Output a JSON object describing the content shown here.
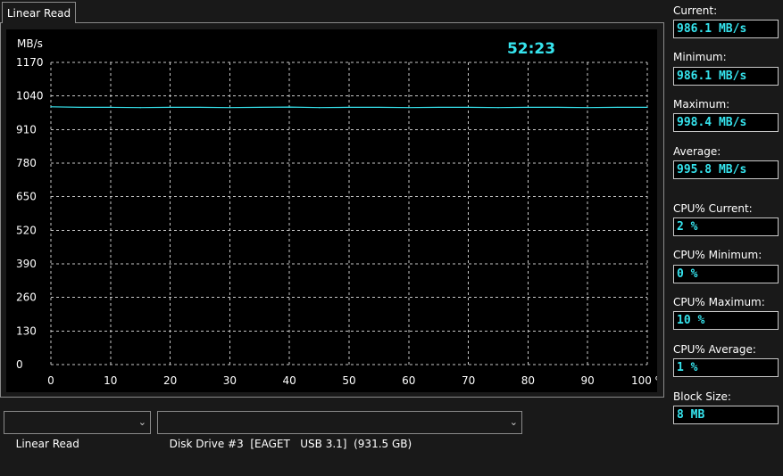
{
  "tab": {
    "label": "Linear Read"
  },
  "chart": {
    "timer": "52:23",
    "y_unit": "MB/s",
    "y_ticks": [
      "1170",
      "1040",
      "910",
      "780",
      "650",
      "520",
      "390",
      "260",
      "130",
      "0"
    ],
    "x_ticks": [
      "0",
      "10",
      "20",
      "30",
      "40",
      "50",
      "60",
      "70",
      "80",
      "90",
      "100 %"
    ],
    "colors": {
      "background": "#000000",
      "grid": "#c8c8c8",
      "line": "#36e4ee",
      "text": "#ffffff",
      "timer": "#36e4ee"
    }
  },
  "chart_data": {
    "type": "line",
    "title": "",
    "xlabel": "",
    "ylabel": "MB/s",
    "xlim": [
      0,
      100
    ],
    "ylim": [
      0,
      1170
    ],
    "grid": true,
    "series": [
      {
        "values_x": [
          0,
          5,
          10,
          15,
          20,
          25,
          30,
          35,
          40,
          45,
          50,
          55,
          60,
          65,
          70,
          75,
          80,
          85,
          90,
          95,
          100
        ],
        "values_y": [
          998,
          996,
          996,
          995,
          996,
          996,
          995,
          996,
          997,
          995,
          996,
          996,
          995,
          996,
          996,
          995,
          996,
          996,
          995,
          996,
          996
        ]
      }
    ]
  },
  "stats": {
    "current_label": "Current:",
    "current_value": "986.1 MB/s",
    "minimum_label": "Minimum:",
    "minimum_value": "986.1 MB/s",
    "maximum_label": "Maximum:",
    "maximum_value": "998.4 MB/s",
    "average_label": "Average:",
    "average_value": "995.8 MB/s",
    "cpu_current_label": "CPU% Current:",
    "cpu_current_value": "2 %",
    "cpu_minimum_label": "CPU% Minimum:",
    "cpu_minimum_value": "0 %",
    "cpu_maximum_label": "CPU% Maximum:",
    "cpu_maximum_value": "10 %",
    "cpu_average_label": "CPU% Average:",
    "cpu_average_value": "1 %",
    "block_size_label": "Block Size:",
    "block_size_value": "8 MB"
  },
  "bottom": {
    "test_select": "Linear Read",
    "drive_select": "Disk Drive #3  [EAGET   USB 3.1]  (931.5 GB)"
  }
}
